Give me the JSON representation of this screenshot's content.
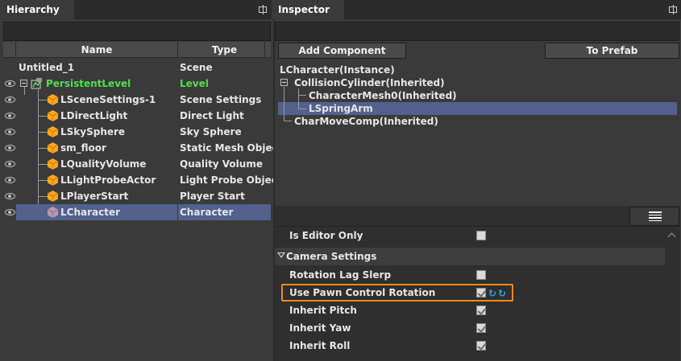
{
  "hierarchy": {
    "tab_title": "Hierarchy",
    "columns": {
      "name": "Name",
      "type": "Type"
    },
    "root": {
      "name": "Untitled_1",
      "type": "Scene"
    },
    "level": {
      "name": "PersistentLevel",
      "type": "Level"
    },
    "items": [
      {
        "name": "LSceneSettings-1",
        "type": "Scene Settings"
      },
      {
        "name": "LDirectLight",
        "type": "Direct Light"
      },
      {
        "name": "LSkySphere",
        "type": "Sky Sphere"
      },
      {
        "name": "sm_floor",
        "type": "Static Mesh Object"
      },
      {
        "name": "LQualityVolume",
        "type": "Quality Volume"
      },
      {
        "name": "LLightProbeActor",
        "type": "Light Probe Object"
      },
      {
        "name": "LPlayerStart",
        "type": "Player Start"
      },
      {
        "name": "LCharacter",
        "type": "Character"
      }
    ],
    "selected_item": "LCharacter"
  },
  "inspector": {
    "tab_title": "Inspector",
    "add_component_label": "Add Component",
    "to_prefab_label": "To Prefab",
    "components": {
      "root": "LCharacter(Instance)",
      "collision": "CollisionCylinder(Inherited)",
      "mesh": "CharacterMesh0(Inherited)",
      "spring_arm": "LSpringArm",
      "move_comp": "CharMoveComp(Inherited)"
    },
    "selected_component": "LSpringArm",
    "properties": {
      "is_editor_only": {
        "label": "Is Editor Only",
        "checked": false
      },
      "category": "Camera Settings",
      "rotation_lag_slerp": {
        "label": "Rotation Lag Slerp",
        "checked": false
      },
      "use_pawn_control_rotation": {
        "label": "Use Pawn Control Rotation",
        "checked": true
      },
      "inherit_pitch": {
        "label": "Inherit Pitch",
        "checked": true
      },
      "inherit_yaw": {
        "label": "Inherit Yaw",
        "checked": true
      },
      "inherit_roll": {
        "label": "Inherit Roll",
        "checked": true
      }
    }
  },
  "colors": {
    "level_green": "#4ce34c",
    "selection": "#52618d",
    "highlight_orange": "#f0891e",
    "cube_orange": "#f5a623",
    "reset_blue": "#2aa7e8"
  },
  "icons": {
    "visibility": "eye-icon",
    "actor": "cube-icon",
    "pin": "pin-icon",
    "menu": "hamburger-menu-icon",
    "reset": "reset-arrow-icon"
  }
}
